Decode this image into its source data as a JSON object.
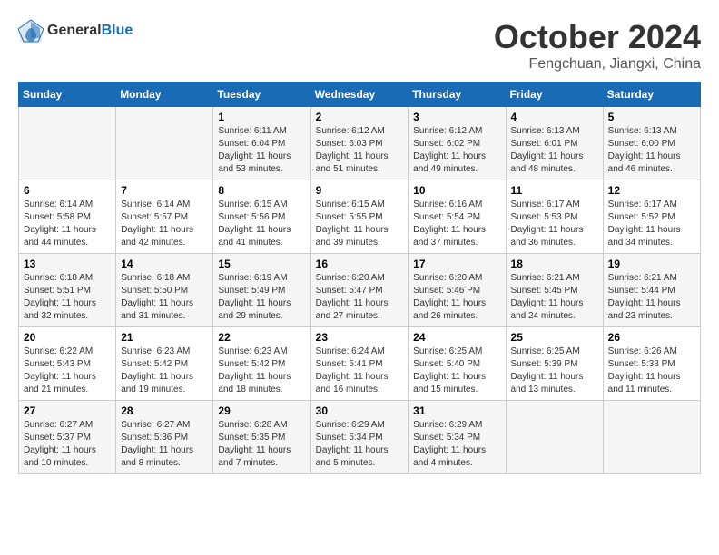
{
  "logo": {
    "text_general": "General",
    "text_blue": "Blue"
  },
  "header": {
    "month": "October 2024",
    "location": "Fengchuan, Jiangxi, China"
  },
  "weekdays": [
    "Sunday",
    "Monday",
    "Tuesday",
    "Wednesday",
    "Thursday",
    "Friday",
    "Saturday"
  ],
  "weeks": [
    [
      {
        "day": "",
        "info": ""
      },
      {
        "day": "",
        "info": ""
      },
      {
        "day": "1",
        "info": "Sunrise: 6:11 AM\nSunset: 6:04 PM\nDaylight: 11 hours and 53 minutes."
      },
      {
        "day": "2",
        "info": "Sunrise: 6:12 AM\nSunset: 6:03 PM\nDaylight: 11 hours and 51 minutes."
      },
      {
        "day": "3",
        "info": "Sunrise: 6:12 AM\nSunset: 6:02 PM\nDaylight: 11 hours and 49 minutes."
      },
      {
        "day": "4",
        "info": "Sunrise: 6:13 AM\nSunset: 6:01 PM\nDaylight: 11 hours and 48 minutes."
      },
      {
        "day": "5",
        "info": "Sunrise: 6:13 AM\nSunset: 6:00 PM\nDaylight: 11 hours and 46 minutes."
      }
    ],
    [
      {
        "day": "6",
        "info": "Sunrise: 6:14 AM\nSunset: 5:58 PM\nDaylight: 11 hours and 44 minutes."
      },
      {
        "day": "7",
        "info": "Sunrise: 6:14 AM\nSunset: 5:57 PM\nDaylight: 11 hours and 42 minutes."
      },
      {
        "day": "8",
        "info": "Sunrise: 6:15 AM\nSunset: 5:56 PM\nDaylight: 11 hours and 41 minutes."
      },
      {
        "day": "9",
        "info": "Sunrise: 6:15 AM\nSunset: 5:55 PM\nDaylight: 11 hours and 39 minutes."
      },
      {
        "day": "10",
        "info": "Sunrise: 6:16 AM\nSunset: 5:54 PM\nDaylight: 11 hours and 37 minutes."
      },
      {
        "day": "11",
        "info": "Sunrise: 6:17 AM\nSunset: 5:53 PM\nDaylight: 11 hours and 36 minutes."
      },
      {
        "day": "12",
        "info": "Sunrise: 6:17 AM\nSunset: 5:52 PM\nDaylight: 11 hours and 34 minutes."
      }
    ],
    [
      {
        "day": "13",
        "info": "Sunrise: 6:18 AM\nSunset: 5:51 PM\nDaylight: 11 hours and 32 minutes."
      },
      {
        "day": "14",
        "info": "Sunrise: 6:18 AM\nSunset: 5:50 PM\nDaylight: 11 hours and 31 minutes."
      },
      {
        "day": "15",
        "info": "Sunrise: 6:19 AM\nSunset: 5:49 PM\nDaylight: 11 hours and 29 minutes."
      },
      {
        "day": "16",
        "info": "Sunrise: 6:20 AM\nSunset: 5:47 PM\nDaylight: 11 hours and 27 minutes."
      },
      {
        "day": "17",
        "info": "Sunrise: 6:20 AM\nSunset: 5:46 PM\nDaylight: 11 hours and 26 minutes."
      },
      {
        "day": "18",
        "info": "Sunrise: 6:21 AM\nSunset: 5:45 PM\nDaylight: 11 hours and 24 minutes."
      },
      {
        "day": "19",
        "info": "Sunrise: 6:21 AM\nSunset: 5:44 PM\nDaylight: 11 hours and 23 minutes."
      }
    ],
    [
      {
        "day": "20",
        "info": "Sunrise: 6:22 AM\nSunset: 5:43 PM\nDaylight: 11 hours and 21 minutes."
      },
      {
        "day": "21",
        "info": "Sunrise: 6:23 AM\nSunset: 5:42 PM\nDaylight: 11 hours and 19 minutes."
      },
      {
        "day": "22",
        "info": "Sunrise: 6:23 AM\nSunset: 5:42 PM\nDaylight: 11 hours and 18 minutes."
      },
      {
        "day": "23",
        "info": "Sunrise: 6:24 AM\nSunset: 5:41 PM\nDaylight: 11 hours and 16 minutes."
      },
      {
        "day": "24",
        "info": "Sunrise: 6:25 AM\nSunset: 5:40 PM\nDaylight: 11 hours and 15 minutes."
      },
      {
        "day": "25",
        "info": "Sunrise: 6:25 AM\nSunset: 5:39 PM\nDaylight: 11 hours and 13 minutes."
      },
      {
        "day": "26",
        "info": "Sunrise: 6:26 AM\nSunset: 5:38 PM\nDaylight: 11 hours and 11 minutes."
      }
    ],
    [
      {
        "day": "27",
        "info": "Sunrise: 6:27 AM\nSunset: 5:37 PM\nDaylight: 11 hours and 10 minutes."
      },
      {
        "day": "28",
        "info": "Sunrise: 6:27 AM\nSunset: 5:36 PM\nDaylight: 11 hours and 8 minutes."
      },
      {
        "day": "29",
        "info": "Sunrise: 6:28 AM\nSunset: 5:35 PM\nDaylight: 11 hours and 7 minutes."
      },
      {
        "day": "30",
        "info": "Sunrise: 6:29 AM\nSunset: 5:34 PM\nDaylight: 11 hours and 5 minutes."
      },
      {
        "day": "31",
        "info": "Sunrise: 6:29 AM\nSunset: 5:34 PM\nDaylight: 11 hours and 4 minutes."
      },
      {
        "day": "",
        "info": ""
      },
      {
        "day": "",
        "info": ""
      }
    ]
  ]
}
